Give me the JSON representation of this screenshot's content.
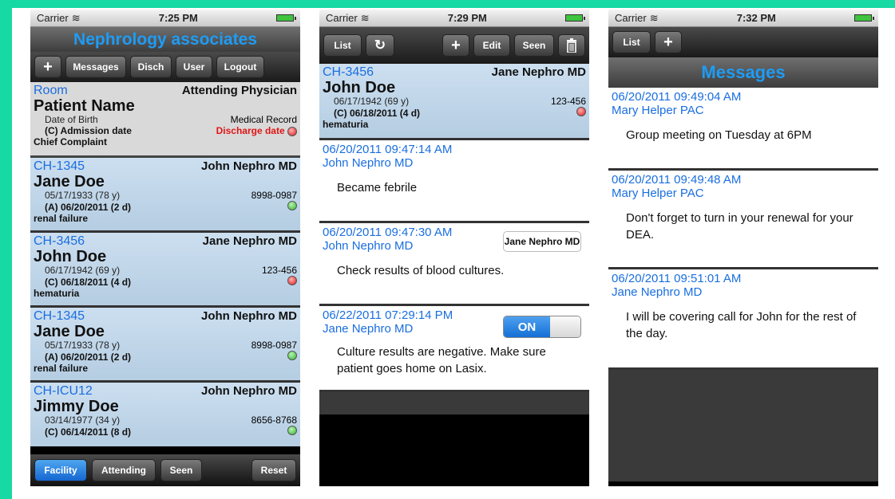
{
  "status": {
    "carrier": "Carrier",
    "phones_time": [
      "7:25 PM",
      "7:29 PM",
      "7:32 PM"
    ]
  },
  "list_screen": {
    "title": "Nephrology associates",
    "toolbar": {
      "plus": "+",
      "messages": "Messages",
      "disch": "Disch",
      "user": "User",
      "logout": "Logout"
    },
    "header": {
      "room": "Room",
      "attending": "Attending Physician",
      "patient_name": "Patient Name",
      "dob": "Date of Birth",
      "medical_record": "Medical Record",
      "admission": "(C) Admission date",
      "discharge": "Discharge date",
      "chief_complaint": "Chief Complaint"
    },
    "patients": [
      {
        "room": "CH-1345",
        "phys": "John Nephro MD",
        "name": "Jane Doe",
        "dob": "05/17/1933 (78 y)",
        "mrn": "8998-0987",
        "adm": "(A) 06/20/2011 (2 d)",
        "complaint": "renal failure",
        "status": "green"
      },
      {
        "room": "CH-3456",
        "phys": "Jane Nephro MD",
        "name": "John Doe",
        "dob": "06/17/1942 (69 y)",
        "mrn": "123-456",
        "adm": "(C) 06/18/2011 (4 d)",
        "complaint": "hematuria",
        "status": "red"
      },
      {
        "room": "CH-1345",
        "phys": "John Nephro MD",
        "name": "Jane Doe",
        "dob": "05/17/1933 (78 y)",
        "mrn": "8998-0987",
        "adm": "(A) 06/20/2011 (2 d)",
        "complaint": "renal failure",
        "status": "green"
      },
      {
        "room": "CH-ICU12",
        "phys": "John Nephro MD",
        "name": "Jimmy Doe",
        "dob": "03/14/1977 (34 y)",
        "mrn": "8656-8768",
        "adm": "(C) 06/14/2011 (8 d)",
        "complaint": "",
        "status": "green"
      }
    ],
    "bottom": {
      "facility": "Facility",
      "attending": "Attending",
      "seen": "Seen",
      "reset": "Reset"
    }
  },
  "detail_screen": {
    "toolbar": {
      "list": "List",
      "refresh": "↻",
      "plus": "+",
      "edit": "Edit",
      "seen": "Seen"
    },
    "patient": {
      "room": "CH-3456",
      "phys": "Jane Nephro MD",
      "name": "John Doe",
      "dob": "06/17/1942 (69 y)",
      "mrn": "123-456",
      "adm": "(C) 06/18/2011 (4 d)",
      "complaint": "hematuria"
    },
    "notes": [
      {
        "ts": "06/20/2011 09:47:14 AM",
        "author": "John Nephro MD",
        "text": "Became febrile"
      },
      {
        "ts": "06/20/2011 09:47:30 AM",
        "author": "John Nephro MD",
        "text": "Check results of blood cultures.",
        "tag": "Jane Nephro MD"
      },
      {
        "ts": "06/22/2011 07:29:14 PM",
        "author": "Jane Nephro MD",
        "text": "Culture results are negative.  Make sure patient goes home on Lasix.",
        "toggle": "ON"
      }
    ]
  },
  "messages_screen": {
    "toolbar": {
      "list": "List",
      "plus": "+"
    },
    "title": "Messages",
    "messages": [
      {
        "ts": "06/20/2011 09:49:04 AM",
        "author": "Mary Helper PAC",
        "text": "Group meeting on Tuesday at 6PM"
      },
      {
        "ts": "06/20/2011 09:49:48 AM",
        "author": "Mary Helper PAC",
        "text": "Don't forget to turn in your renewal for your DEA."
      },
      {
        "ts": "06/20/2011 09:51:01 AM",
        "author": "Jane Nephro MD",
        "text": "I will be covering call for John for the rest of the day."
      }
    ]
  },
  "colors": {
    "accent": "#1a6ee0",
    "frame": "#17d9a3",
    "discharge": "#e01616"
  }
}
